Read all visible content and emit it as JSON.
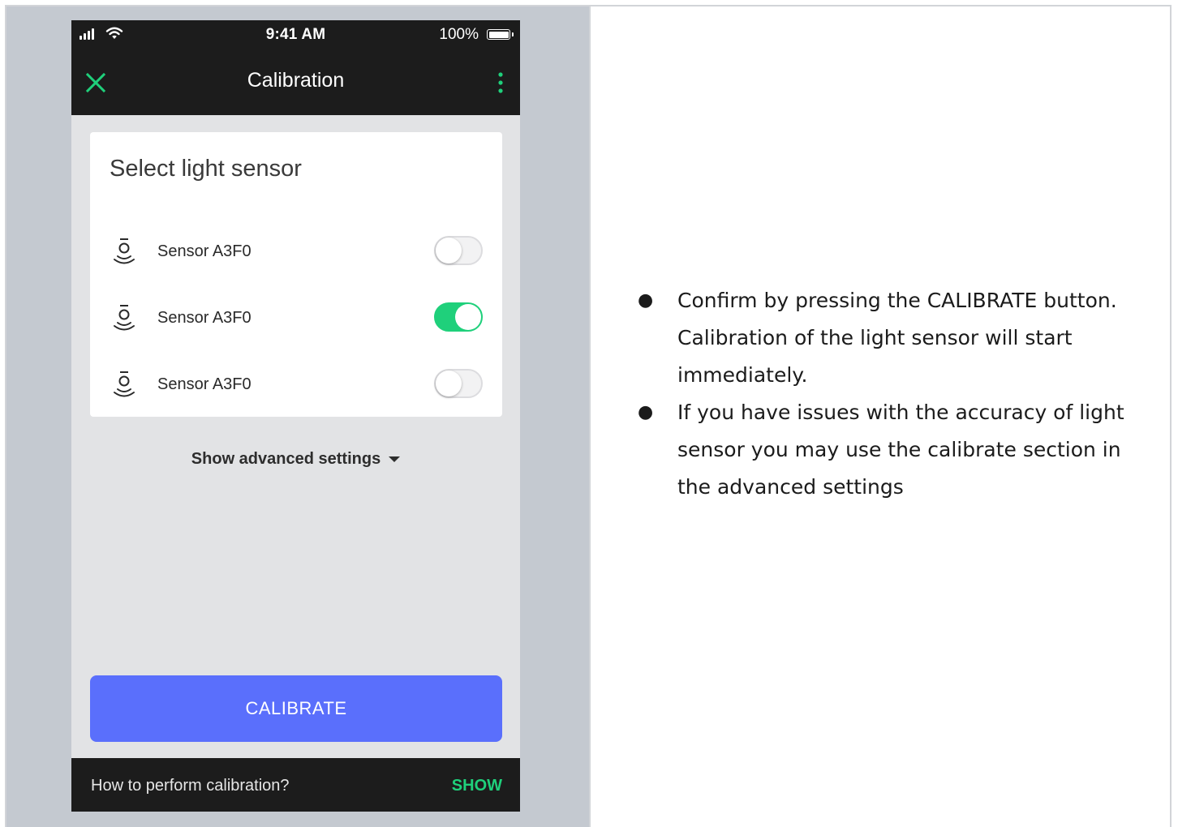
{
  "status_bar": {
    "time": "9:41 AM",
    "battery": "100%"
  },
  "app_bar": {
    "title": "Calibration"
  },
  "card": {
    "title": "Select light sensor",
    "sensors": [
      {
        "label": "Sensor A3F0",
        "enabled": false
      },
      {
        "label": "Sensor A3F0",
        "enabled": true
      },
      {
        "label": "Sensor A3F0",
        "enabled": false
      }
    ]
  },
  "advanced_label": "Show advanced settings",
  "calibrate_label": "CALIBRATE",
  "snackbar": {
    "text": "How to perform calibration?",
    "action": "SHOW"
  },
  "notes": [
    "Confirm by pressing the CALIBRATE button. Calibration of the light sensor will start immediately.",
    "If you have issues with the accuracy of light sensor you may use the calibrate section in the advanced settings"
  ],
  "colors": {
    "accent_green": "#1fd07b",
    "primary_blue": "#5a6ffc",
    "bar_dark": "#1c1c1c"
  },
  "icons": [
    "signal-icon",
    "wifi-icon",
    "battery-icon",
    "close-icon",
    "more-vert-icon",
    "light-sensor-icon",
    "caret-down-icon"
  ]
}
